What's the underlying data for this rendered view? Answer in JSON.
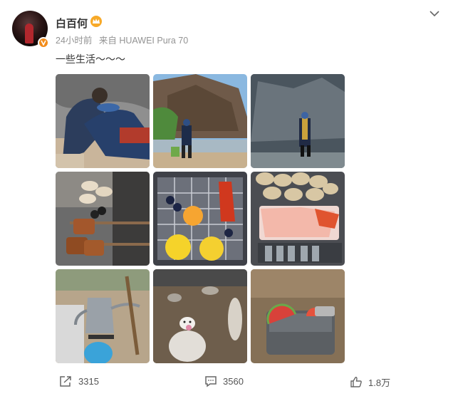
{
  "post": {
    "username": "白百何",
    "time": "24小时前",
    "source": "来自 HUAWEI Pura 70",
    "text": "一些生活～～～"
  },
  "icons": {
    "avatar_badge": "v-verified-icon",
    "user_badge": "crown-icon",
    "menu": "chevron-down-icon",
    "repost": "share-icon",
    "comment": "comment-icon",
    "like": "thumbs-up-icon"
  },
  "photos": [
    {
      "name": "two people crouching by rocks"
    },
    {
      "name": "person by river with cliff"
    },
    {
      "name": "person standing by rock wall"
    },
    {
      "name": "grilled skewers and shells"
    },
    {
      "name": "grill basket with fruit and lobster"
    },
    {
      "name": "sashimi platter with shellfish"
    },
    {
      "name": "camping kettle and gas canister"
    },
    {
      "name": "small toy on rock"
    },
    {
      "name": "watermelon slices on cooler"
    }
  ],
  "actions": {
    "repost_count": "3315",
    "comment_count": "3560",
    "like_count": "1.8万"
  },
  "colors": {
    "accent_orange": "#f28c1b",
    "text_gray": "#939393"
  }
}
